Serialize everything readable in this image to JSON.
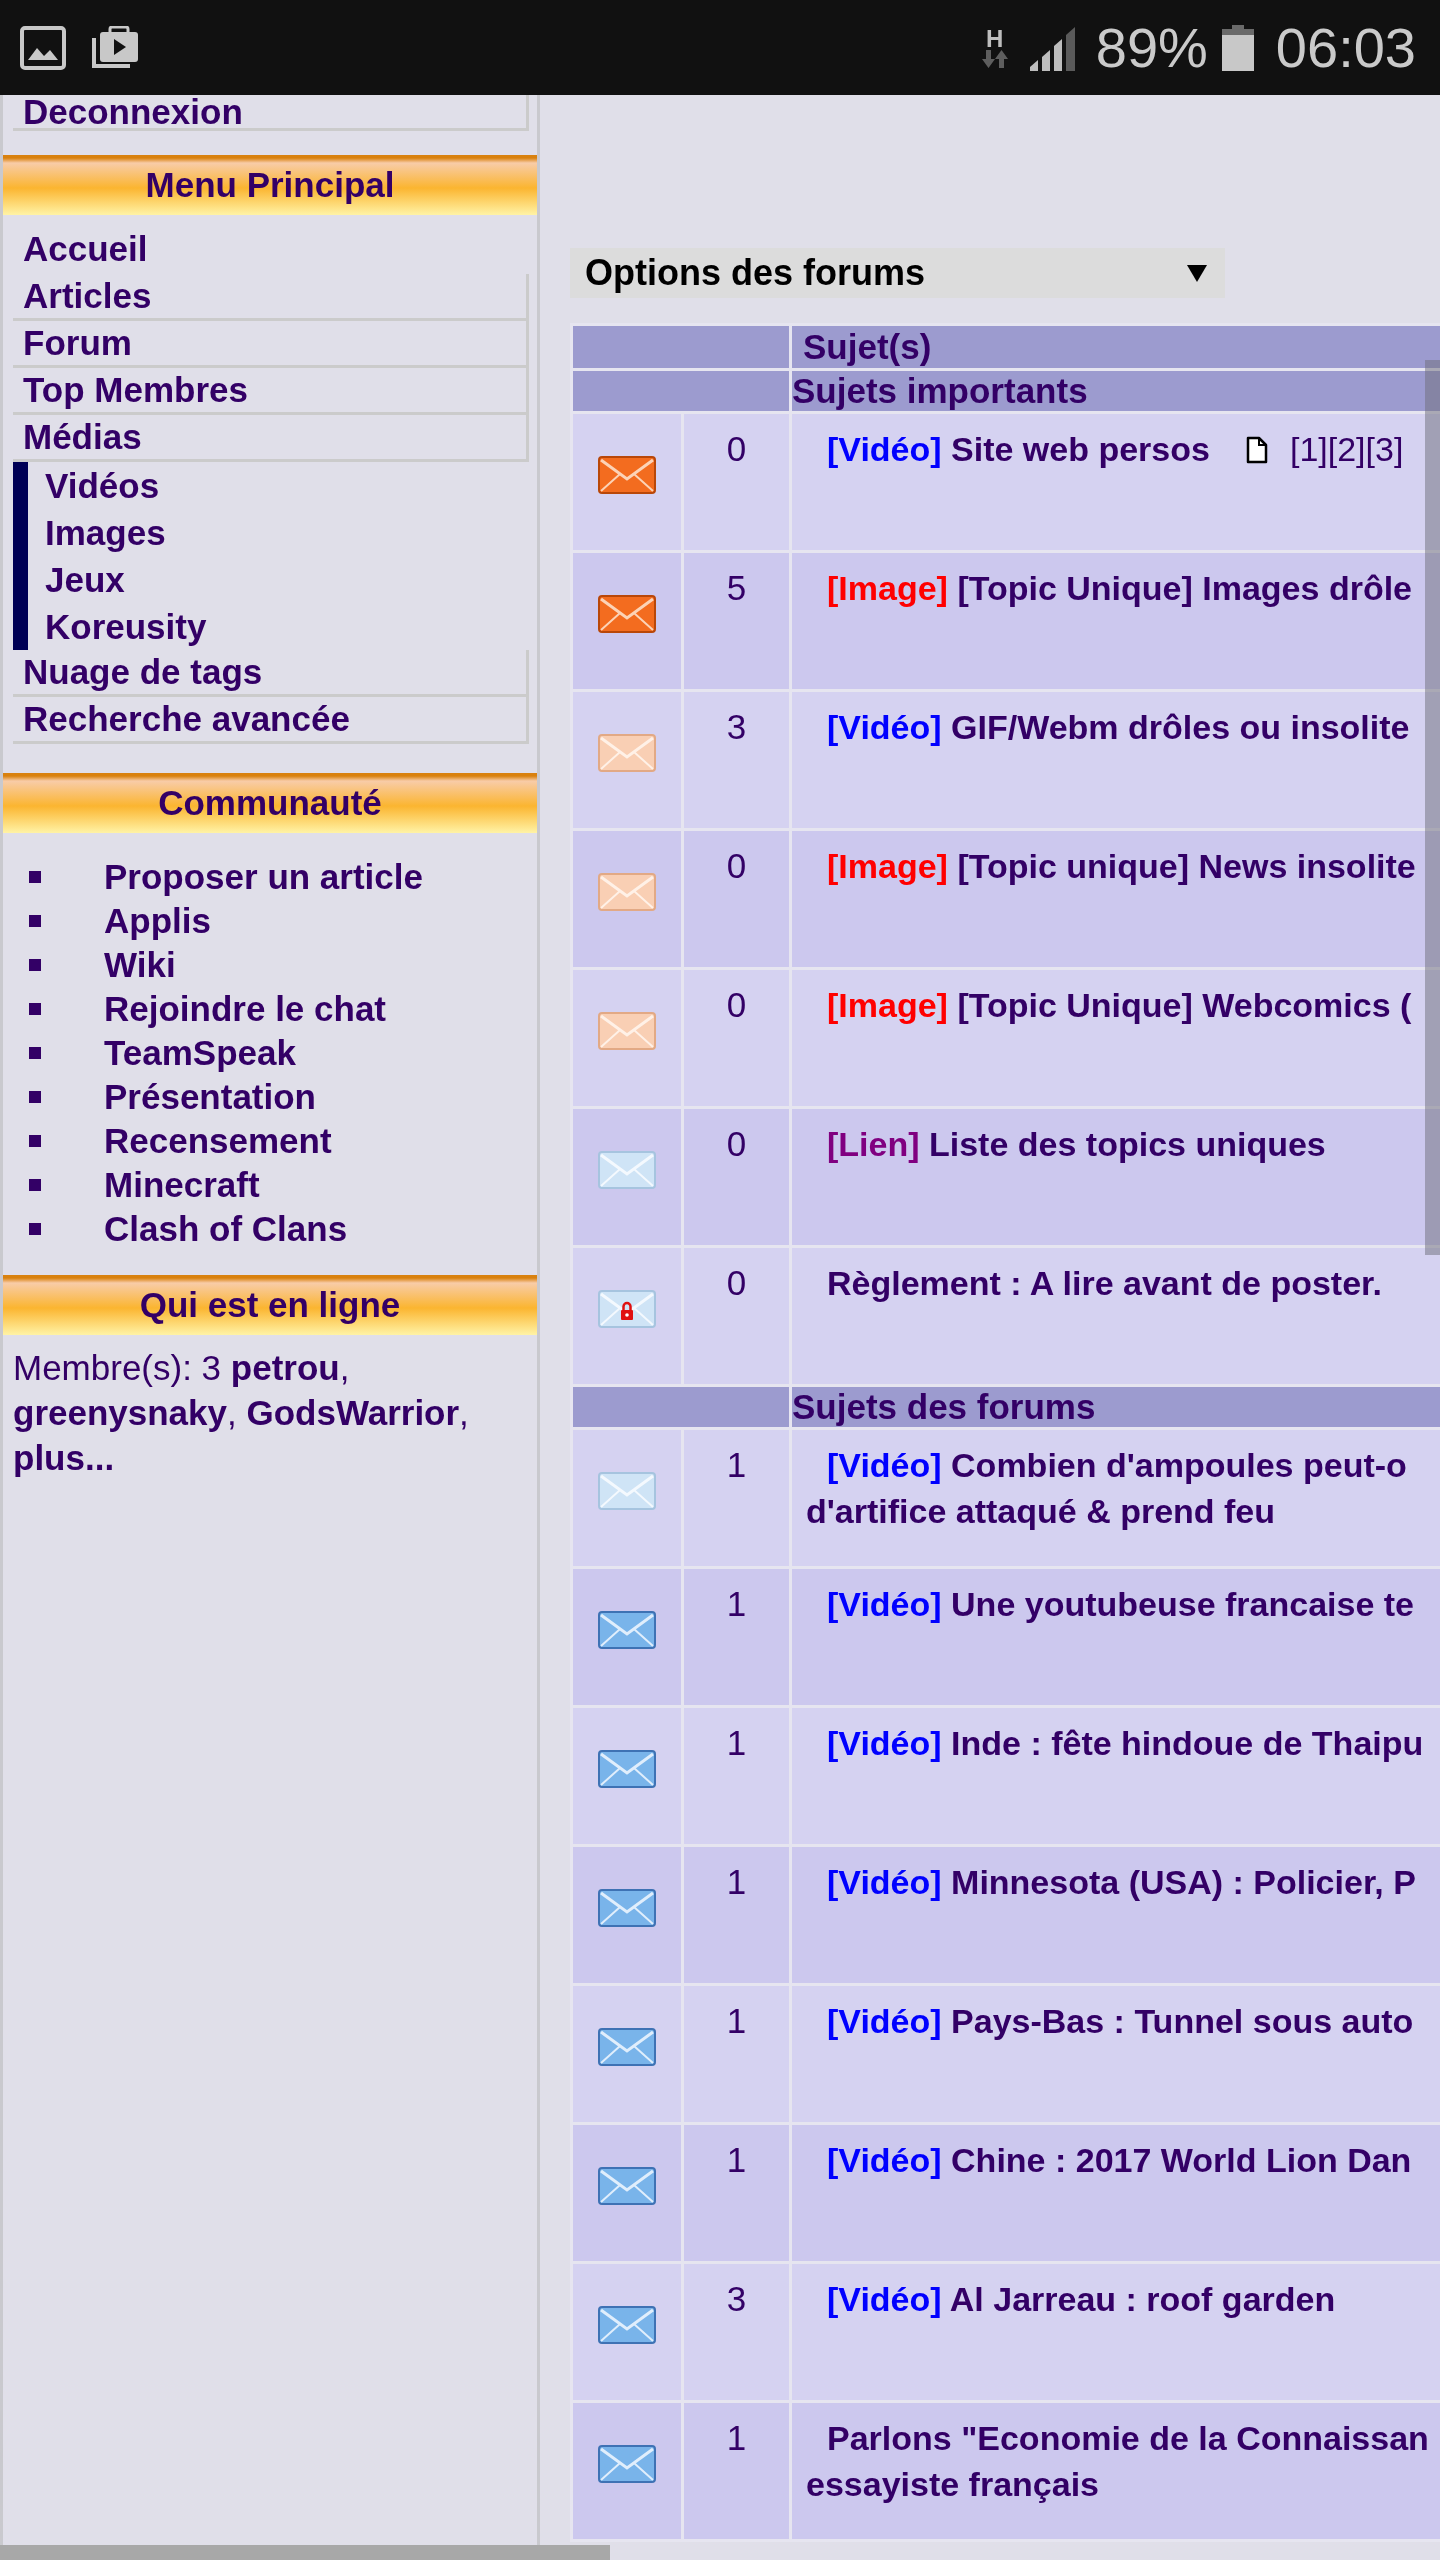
{
  "status_bar": {
    "network_type": "H",
    "battery": "89%",
    "time": "06:03"
  },
  "sidebar": {
    "account_link": "Deconnexion",
    "blocks": [
      {
        "kind": "menu",
        "title": "Menu Principal",
        "items": [
          {
            "label": "Accueil"
          },
          {
            "label": "Articles"
          },
          {
            "label": "Forum"
          },
          {
            "label": "Top Membres"
          },
          {
            "label": "Médias",
            "children": [
              {
                "label": "Vidéos"
              },
              {
                "label": "Images"
              },
              {
                "label": "Jeux"
              },
              {
                "label": "Koreusity"
              }
            ]
          },
          {
            "label": "Nuage de tags"
          },
          {
            "label": "Recherche avancée"
          }
        ]
      },
      {
        "kind": "bullets",
        "title": "Communauté",
        "items": [
          {
            "label": "Proposer un article"
          },
          {
            "label": "Applis"
          },
          {
            "label": "Wiki"
          },
          {
            "label": "Rejoindre le chat"
          },
          {
            "label": "TeamSpeak"
          },
          {
            "label": "Présentation"
          },
          {
            "label": "Recensement"
          },
          {
            "label": "Minecraft"
          },
          {
            "label": "Clash of Clans"
          }
        ]
      },
      {
        "kind": "text",
        "title": "Qui est en ligne",
        "text": "Membre(s): 3 **petrou**, **greenysnaky**, **GodsWarrior**, **plus...**"
      }
    ]
  },
  "forum_options": {
    "label": "Options des forums"
  },
  "topics_table": {
    "column_header": "Sujet(s)",
    "sections": [
      {
        "title": "Sujets importants",
        "topics": [
          {
            "hot": true,
            "unread": true,
            "locked": false,
            "replies": "0",
            "tag": {
              "text": "[Vidéo]",
              "color": "#0000ff"
            },
            "title_lines": [
              "Site web persos"
            ],
            "pages": [
              "[1]",
              "[2]",
              "[3]"
            ]
          },
          {
            "hot": true,
            "unread": true,
            "locked": false,
            "replies": "5",
            "tag": {
              "text": "[Image]",
              "color": "#ff0000"
            },
            "title_lines": [
              "[Topic Unique] Images drôle"
            ]
          },
          {
            "hot": true,
            "unread": false,
            "locked": false,
            "replies": "3",
            "tag": {
              "text": "[Vidéo]",
              "color": "#0000ff"
            },
            "title_lines": [
              "GIF/Webm drôles ou insolite"
            ]
          },
          {
            "hot": true,
            "unread": false,
            "locked": false,
            "replies": "0",
            "tag": {
              "text": "[Image]",
              "color": "#ff0000"
            },
            "title_lines": [
              "[Topic unique] News insolite"
            ]
          },
          {
            "hot": true,
            "unread": false,
            "locked": false,
            "replies": "0",
            "tag": {
              "text": "[Image]",
              "color": "#ff0000"
            },
            "title_lines": [
              "[Topic Unique] Webcomics ("
            ]
          },
          {
            "hot": false,
            "unread": false,
            "locked": false,
            "replies": "0",
            "tag": {
              "text": "[Lien]",
              "color": "#800080"
            },
            "title_lines": [
              "Liste des topics uniques"
            ]
          },
          {
            "hot": false,
            "unread": false,
            "locked": true,
            "replies": "0",
            "title_lines": [
              "Règlement : A lire avant de poster."
            ]
          }
        ]
      },
      {
        "title": "Sujets des forums",
        "topics": [
          {
            "hot": false,
            "unread": false,
            "locked": false,
            "replies": "1",
            "tag": {
              "text": "[Vidéo]",
              "color": "#0000ff"
            },
            "title_lines": [
              "Combien d'ampoules peut-o",
              "d'artifice attaqué & prend feu"
            ]
          },
          {
            "hot": false,
            "unread": true,
            "locked": false,
            "replies": "1",
            "tag": {
              "text": "[Vidéo]",
              "color": "#0000ff"
            },
            "title_lines": [
              "Une youtubeuse francaise te"
            ]
          },
          {
            "hot": false,
            "unread": true,
            "locked": false,
            "replies": "1",
            "tag": {
              "text": "[Vidéo]",
              "color": "#0000ff"
            },
            "title_lines": [
              "Inde : fête hindoue de Thaipu"
            ]
          },
          {
            "hot": false,
            "unread": true,
            "locked": false,
            "replies": "1",
            "tag": {
              "text": "[Vidéo]",
              "color": "#0000ff"
            },
            "title_lines": [
              "Minnesota (USA) : Policier, P"
            ]
          },
          {
            "hot": false,
            "unread": true,
            "locked": false,
            "replies": "1",
            "tag": {
              "text": "[Vidéo]",
              "color": "#0000ff"
            },
            "title_lines": [
              "Pays-Bas : Tunnel sous auto"
            ]
          },
          {
            "hot": false,
            "unread": true,
            "locked": false,
            "replies": "1",
            "tag": {
              "text": "[Vidéo]",
              "color": "#0000ff"
            },
            "title_lines": [
              "Chine : 2017 World Lion Dan"
            ]
          },
          {
            "hot": false,
            "unread": true,
            "locked": false,
            "replies": "3",
            "tag": {
              "text": "[Vidéo]",
              "color": "#0000ff"
            },
            "title_lines": [
              "Al Jarreau : roof garden"
            ]
          },
          {
            "hot": false,
            "unread": true,
            "locked": false,
            "replies": "1",
            "title_lines": [
              "Parlons \"Economie de la Connaissan",
              "essayiste français"
            ]
          }
        ]
      }
    ]
  }
}
